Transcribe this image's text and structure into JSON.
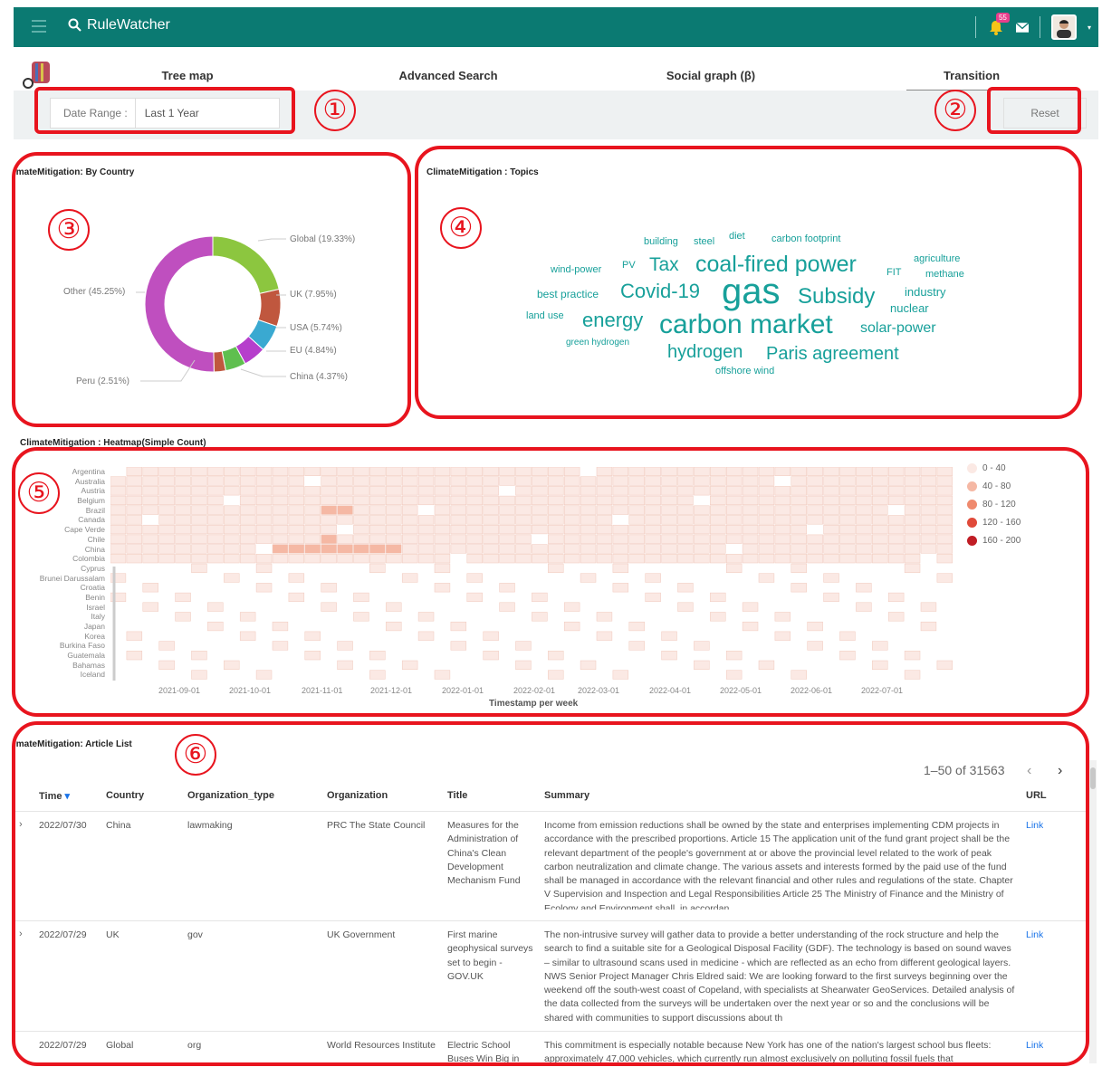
{
  "app": {
    "brand": "RuleWatcher",
    "notification_count": "55"
  },
  "tabs": [
    {
      "label": "Tree map"
    },
    {
      "label": "Advanced Search"
    },
    {
      "label": "Social graph (β)"
    },
    {
      "label": "Transition",
      "active": true
    }
  ],
  "filters": {
    "date_range_label": "Date Range :",
    "date_range_value": "Last 1 Year",
    "reset_label": "Reset"
  },
  "annotations": [
    "①",
    "②",
    "③",
    "④",
    "⑤",
    "⑥"
  ],
  "by_country": {
    "title": "imateMitigation: By Country",
    "chart_data": {
      "type": "pie",
      "categories": [
        "Global",
        "UK",
        "USA",
        "EU",
        "China",
        "Peru",
        "Other"
      ],
      "values": [
        19.33,
        7.95,
        5.74,
        4.84,
        4.37,
        2.51,
        45.25
      ],
      "labels": [
        "Global (19.33%)",
        "UK (7.95%)",
        "USA (5.74%)",
        "EU (4.84%)",
        "China (4.37%)",
        "Peru (2.51%)",
        "Other (45.25%)"
      ],
      "colors": [
        "#8cc63f",
        "#c0573e",
        "#3aa9d1",
        "#b63fcc",
        "#5fbf4f",
        "#c0573e",
        "#bf4fbf"
      ]
    }
  },
  "topics": {
    "title": "ClimateMitigation : Topics",
    "words": [
      "building",
      "steel",
      "diet",
      "carbon footprint",
      "wind-power",
      "PV",
      "Tax",
      "coal-fired power",
      "FIT",
      "agriculture",
      "methane",
      "best practice",
      "Covid-19",
      "gas",
      "Subsidy",
      "industry",
      "nuclear",
      "land use",
      "energy",
      "carbon market",
      "solar-power",
      "green hydrogen",
      "hydrogen",
      "Paris agreement",
      "offshore wind"
    ]
  },
  "heatmap": {
    "title": "ClimateMitigation : Heatmap(Simple Count)",
    "chart_data": {
      "type": "heatmap",
      "y_categories": [
        "Argentina",
        "Australia",
        "Austria",
        "Belgium",
        "Brazil",
        "Canada",
        "Cape Verde",
        "Chile",
        "China",
        "Colombia",
        "Cyprus",
        "Brunei Darussalam",
        "Croatia",
        "Benin",
        "Israel",
        "Italy",
        "Japan",
        "Korea",
        "Burkina Faso",
        "Guatemala",
        "Bahamas",
        "Iceland"
      ],
      "x_ticks": [
        "2021-09-01",
        "2021-10-01",
        "2021-11-01",
        "2021-12-01",
        "2022-01-01",
        "2022-02-01",
        "2022-03-01",
        "2022-04-01",
        "2022-05-01",
        "2022-06-01",
        "2022-07-01"
      ],
      "xlabel": "Timestamp per week",
      "legend": [
        "0 - 40",
        "40 - 80",
        "80 - 120",
        "120 - 160",
        "160 - 200"
      ],
      "legend_colors": [
        "#fbe9e4",
        "#f5b8a4",
        "#ef8a6e",
        "#e04a3a",
        "#c01d25"
      ]
    }
  },
  "articles": {
    "title": "imateMitigation: Article List",
    "pagination": "1–50 of 31563",
    "columns": [
      "Time",
      "Country",
      "Organization_type",
      "Organization",
      "Title",
      "Summary",
      "URL"
    ],
    "rows": [
      {
        "time": "2022/07/30",
        "country": "China",
        "org_type": "lawmaking",
        "org": "PRC The State Council",
        "title": "Measures for the Administration of China's Clean Development Mechanism Fund",
        "summary": "Income from emission reductions shall be owned by the state and enterprises implementing CDM projects in accordance with the prescribed proportions. Article 15 The application unit of the fund grant project shall be the relevant department of the people's government at or above the provincial level related to the work of peak carbon neutralization and climate change. The various assets and interests formed by the paid use of the fund shall be managed in accordance with the relevant financial and other rules and regulations of the state. Chapter V Supervision and Inspection and Legal Responsibilities Article 25 The Ministry of Finance and the Ministry of Ecology and Environment shall, in accordan",
        "url": "Link"
      },
      {
        "time": "2022/07/29",
        "country": "UK",
        "org_type": "gov",
        "org": "UK Government",
        "title": "First marine geophysical surveys set to begin - GOV.UK",
        "summary": "The non-intrusive survey will gather data to provide a better understanding of the rock structure and help the search to find a suitable site for a Geological Disposal Facility (GDF). The technology is based on sound waves – similar to ultrasound scans used in medicine - which are reflected as an echo from different geological layers. NWS Senior Project Manager Chris Eldred said: We are looking forward to the first surveys beginning over the weekend off the south-west coast of Copeland, with specialists at Shearwater GeoServices. Detailed analysis of the data collected from the surveys will be undertaken over the next year or so and the conclusions will be shared with communities to support discussions about th",
        "url": "Link"
      },
      {
        "time": "2022/07/29",
        "country": "Global",
        "org_type": "org",
        "org": "World Resources Institute",
        "title": "Electric School Buses Win Big in US",
        "summary": "This commitment is especially notable because New York has one of the nation's largest school bus fleets: approximately 47,000 vehicles, which currently run almost exclusively on polluting fossil fuels that",
        "url": "Link"
      }
    ]
  }
}
